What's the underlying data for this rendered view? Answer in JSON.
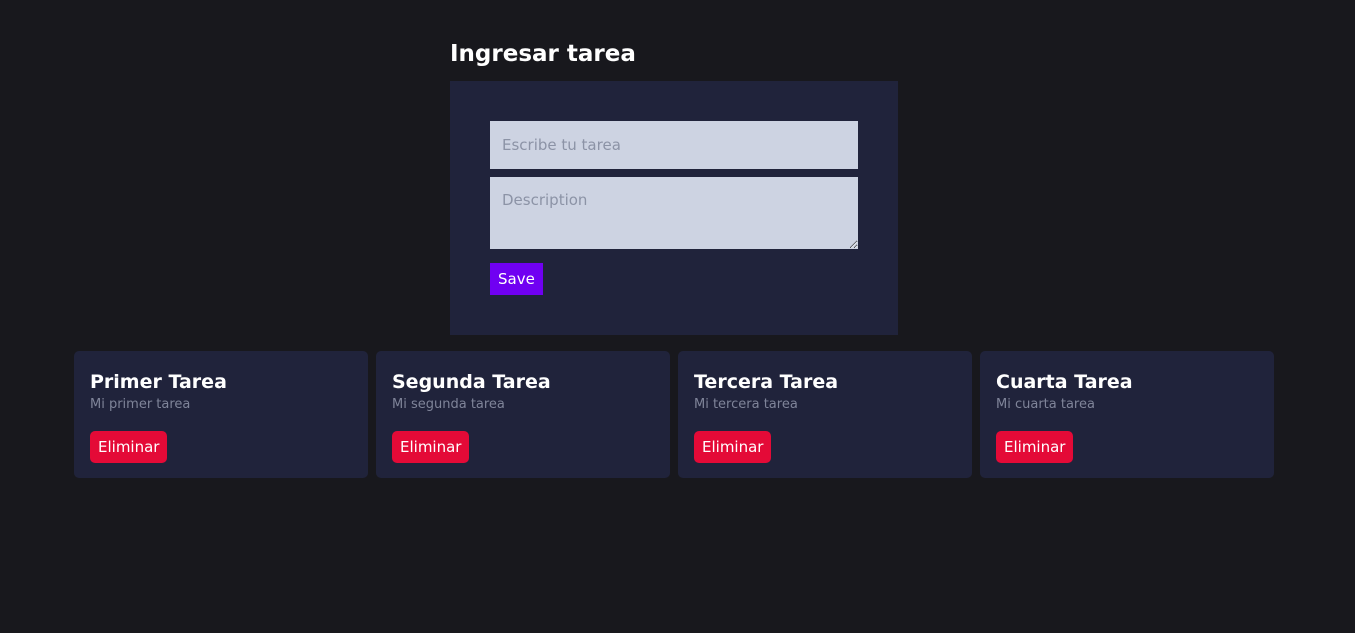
{
  "form": {
    "title": "Ingresar tarea",
    "title_input_placeholder": "Escribe tu tarea",
    "description_placeholder": "Description",
    "save_label": "Save"
  },
  "tasks": [
    {
      "title": "Primer Tarea",
      "description": "Mi primer tarea",
      "delete_label": "Eliminar"
    },
    {
      "title": "Segunda Tarea",
      "description": "Mi segunda tarea",
      "delete_label": "Eliminar"
    },
    {
      "title": "Tercera Tarea",
      "description": "Mi tercera tarea",
      "delete_label": "Eliminar"
    },
    {
      "title": "Cuarta Tarea",
      "description": "Mi cuarta tarea",
      "delete_label": "Eliminar"
    }
  ],
  "colors": {
    "page_background": "#18181d",
    "card_background": "#20233b",
    "input_background": "#cdd3e2",
    "save_button": "#7000f2",
    "delete_button": "#e40a37",
    "muted_text": "#7f8499"
  }
}
